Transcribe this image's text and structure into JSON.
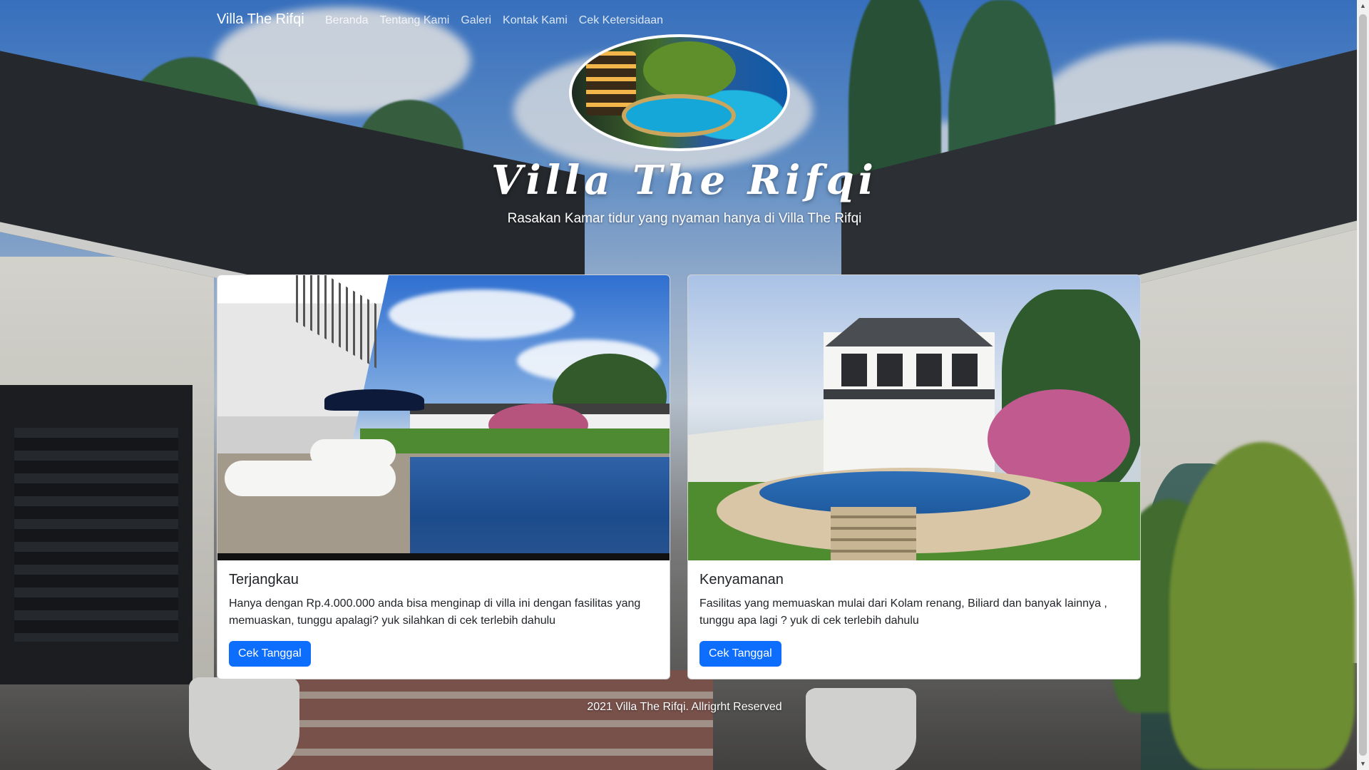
{
  "navbar": {
    "brand": "Villa The Rifqi",
    "links": [
      "Beranda",
      "Tentang Kami",
      "Galeri",
      "Kontak Kami",
      "Cek Ketersidaan"
    ]
  },
  "hero": {
    "title": "Villa The Rifqi",
    "subtitle": "Rasakan Kamar tidur yang nyaman hanya di Villa The Rifqi"
  },
  "cards": [
    {
      "title": "Terjangkau",
      "text": "Hanya dengan Rp.4.000.000 anda bisa menginap di villa ini dengan fasilitas yang memuaskan, tunggu apalagi? yuk silahkan di cek terlebih dahulu",
      "button": "Cek Tanggal"
    },
    {
      "title": "Kenyamanan",
      "text": "Fasilitas yang memuaskan mulai dari Kolam renang, Biliard dan banyak lainnya , tunggu apa lagi ? yuk di cek terlebih dahulu",
      "button": "Cek Tanggal"
    }
  ],
  "footer": {
    "text": "2021 Villa The Rifqi. Allrigrht Reserved"
  },
  "colors": {
    "primary_button": "#0d6efd",
    "text_dark": "#212529",
    "nav_text": "#ffffff"
  },
  "icons": {
    "scroll_up": "scroll-up-arrow-icon",
    "scroll_down": "scroll-down-arrow-icon"
  }
}
